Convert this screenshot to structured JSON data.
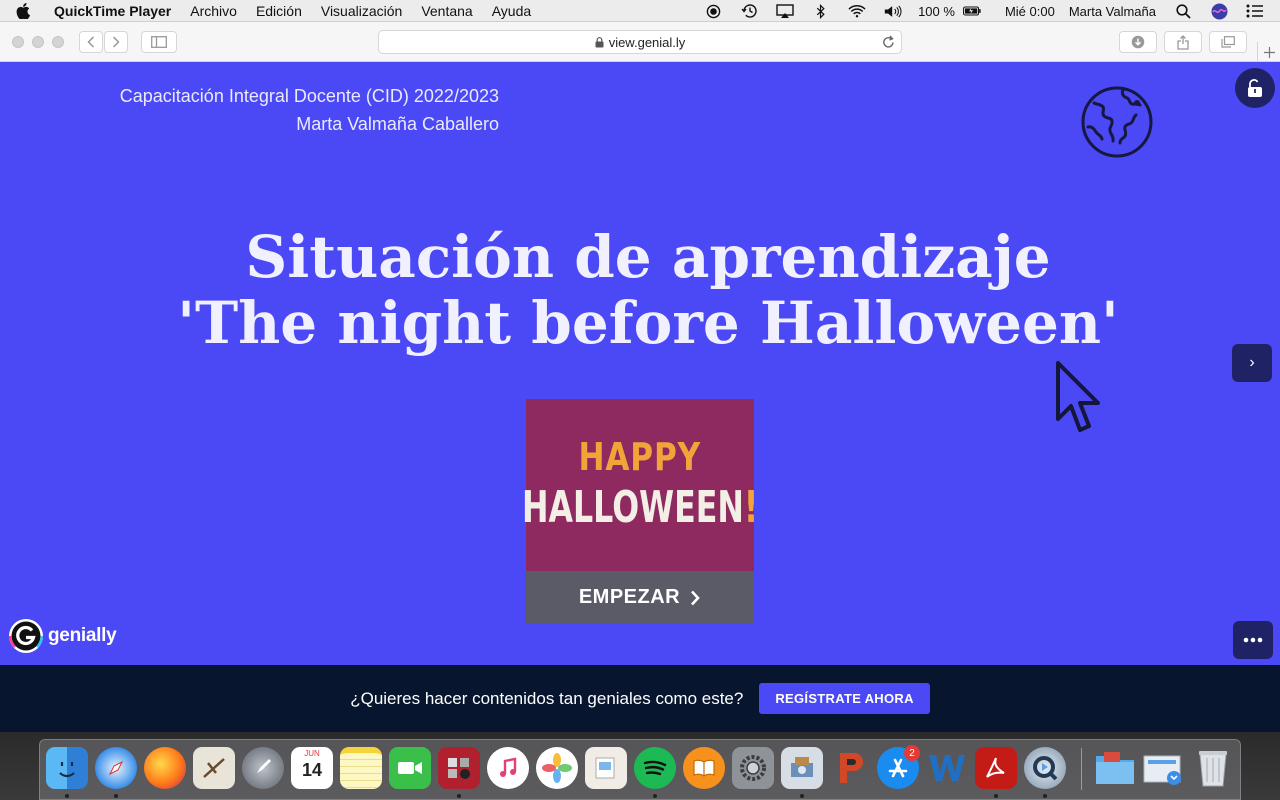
{
  "menubar": {
    "app": "QuickTime Player",
    "menus": [
      "Archivo",
      "Edición",
      "Visualización",
      "Ventana",
      "Ayuda"
    ],
    "battery": "100 %",
    "clock": "Mié 0:00",
    "user": "Marta Valmaña"
  },
  "browser": {
    "url": "view.genial.ly"
  },
  "slide": {
    "course": "Capacitación Integral Docente (CID) 2022/2023",
    "author": "Marta Valmaña Caballero",
    "title_line1": "Situación de aprendizaje",
    "title_line2": "'The night before Halloween'",
    "image_happy": "HAPPY",
    "image_halloween": "HALLOWEEN",
    "image_bang": "!",
    "start_label": "EMPEZAR",
    "brand": "genially",
    "next_icon": "›",
    "colors": {
      "background": "#4b49f6",
      "controls": "#1f2365",
      "card": "#8e2a60",
      "button": "#5b5b68"
    }
  },
  "promo": {
    "text": "¿Quieres hacer contenidos tan geniales como este?",
    "cta": "REGÍSTRATE AHORA"
  },
  "dock": {
    "calendar_day": "14",
    "calendar_month": "JUN",
    "appstore_badge": "2",
    "icons": [
      "finder-icon",
      "safari-icon",
      "firefox-icon",
      "mail-icon",
      "launchpad-icon",
      "calendar-icon",
      "notes-icon",
      "facetime-icon",
      "photo-booth-icon",
      "itunes-icon",
      "photos-icon",
      "preview-icon",
      "spotify-icon",
      "books-icon",
      "system-preferences-icon",
      "image-capture-icon",
      "powerpoint-icon",
      "app-store-icon",
      "word-icon",
      "acrobat-icon",
      "quicktime-icon",
      "documents-folder-icon",
      "downloads-folder-icon",
      "trash-icon"
    ]
  }
}
